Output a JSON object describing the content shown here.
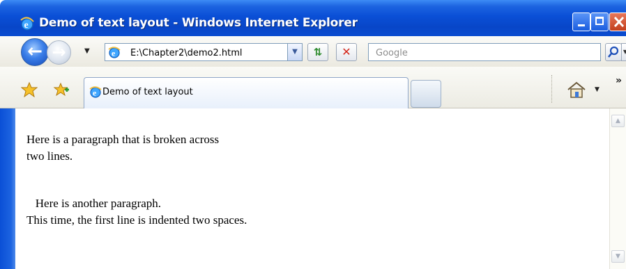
{
  "window": {
    "title": "Demo of text layout - Windows Internet Explorer"
  },
  "nav": {
    "address": "E:\\Chapter2\\demo2.html",
    "search_placeholder": "Google"
  },
  "tab": {
    "label": "Demo of text layout"
  },
  "toolbar": {
    "overflow_chevron": "»"
  },
  "page": {
    "paragraph1_line1": "Here is a paragraph that is broken across",
    "paragraph1_line2": "two lines.",
    "paragraph2_line1": "   Here is another paragraph.",
    "paragraph2_line2": "This time, the first line is indented two spaces."
  },
  "icons": [
    "ie-icon",
    "back-icon",
    "forward-icon",
    "refresh-icon",
    "stop-icon",
    "search-icon",
    "favorites-star-icon",
    "add-favorites-icon",
    "home-icon",
    "scroll-up-icon",
    "scroll-down-icon"
  ],
  "colors": {
    "titlebar": "#0a4fd6",
    "close_button": "#c2401e",
    "page_background": "#ffffff"
  }
}
